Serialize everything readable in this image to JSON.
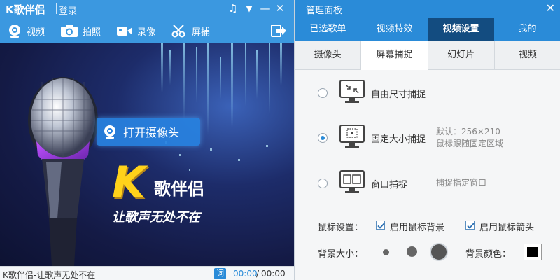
{
  "app": {
    "title": "K歌伴侣",
    "login": "登录",
    "toolbar": [
      "视频",
      "拍照",
      "录像",
      "屏捕"
    ],
    "camera_button": "打开摄像头",
    "logo_big": "K",
    "logo_text": "歌伴侣",
    "slogan": "让歌声无处不在",
    "status": {
      "song": "K歌伴侣-让歌声无处不在",
      "lyric_button": "词",
      "current_time": "00:00",
      "separator": "/",
      "total_time": "00:00"
    }
  },
  "panel": {
    "title": "管理面板",
    "main_tabs": [
      "已选歌单",
      "视频特效",
      "视频设置",
      "我的"
    ],
    "active_main_tab": "视频设置",
    "sub_tabs": [
      "摄像头",
      "屏幕捕捉",
      "幻灯片",
      "视频"
    ],
    "active_sub_tab": "屏幕捕捉",
    "options": [
      {
        "label": "自由尺寸捕捉",
        "desc1": "",
        "desc2": "",
        "checked": false
      },
      {
        "label": "固定大小捕捉",
        "desc1": "默认：256×210",
        "desc2": "鼠标跟随固定区域",
        "checked": true
      },
      {
        "label": "窗口捕捉",
        "desc1": "捕捉指定窗口",
        "desc2": "",
        "checked": false
      }
    ],
    "mouse_settings": {
      "label": "鼠标设置：",
      "bg_checkbox": "启用鼠标背景",
      "arrow_checkbox": "启用鼠标箭头"
    },
    "bg_size": {
      "label": "背景大小：",
      "selected_level": 3,
      "levels": 3
    },
    "bg_color": {
      "label": "背景颜色：",
      "value": "#000000"
    }
  },
  "colors": {
    "accent": "#2a8bd8",
    "active_tab": "#134c80"
  }
}
